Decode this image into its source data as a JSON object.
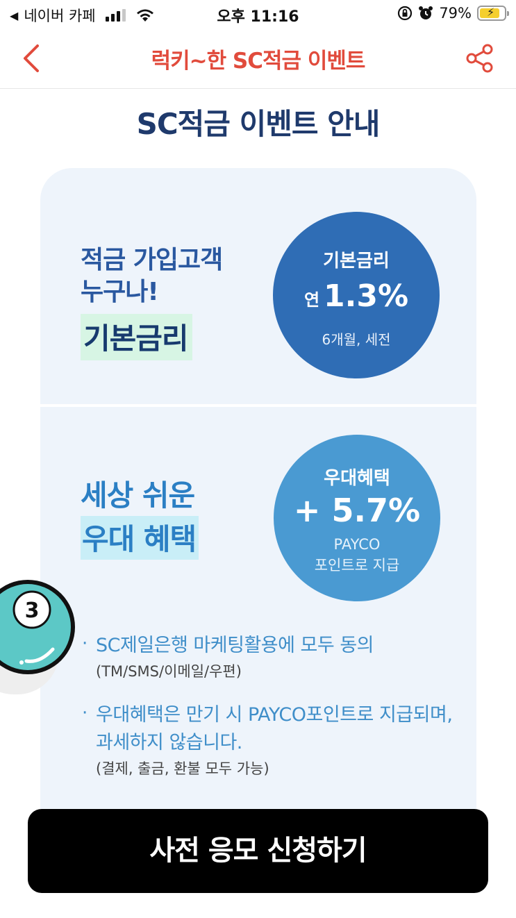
{
  "status_bar": {
    "back_app": "네이버 카페",
    "time": "오후 11:16",
    "battery": "79%"
  },
  "nav": {
    "title": "럭키~한 SC적금 이벤트"
  },
  "main": {
    "section_title": "SC적금 이벤트 안내",
    "block1": {
      "line1": "적금 가입고객",
      "line2": "누구나!",
      "highlight": "기본금리",
      "circle": {
        "label": "기본금리",
        "rate_prefix": "연",
        "rate": "1.3%",
        "sub": "6개월, 세전"
      }
    },
    "block2": {
      "line1": "세상 쉬운",
      "highlight": "우대 혜택",
      "circle": {
        "label": "우대혜택",
        "rate": "+ 5.7%",
        "sub1": "PAYCO",
        "sub2": "포인트로 지급"
      }
    },
    "notes": [
      {
        "main": "SC제일은행 마케팅활용에 모두 동의",
        "sub": "(TM/SMS/이메일/우편)"
      },
      {
        "main": "우대혜택은 만기 시 PAYCO포인트로 지급되며, 과세하지 않습니다.",
        "sub": "(결제, 출금, 환불 모두 가능)"
      }
    ]
  },
  "badge": {
    "number": "3"
  },
  "cta": {
    "label": "사전 응모 신청하기"
  },
  "colors": {
    "nav_title": "#e14b3c",
    "section_title": "#1f3a6c",
    "card_bg": "#eef4fb",
    "circle1": "#2f6db5",
    "circle2": "#4a9ad2",
    "cta_bg": "#000000"
  }
}
